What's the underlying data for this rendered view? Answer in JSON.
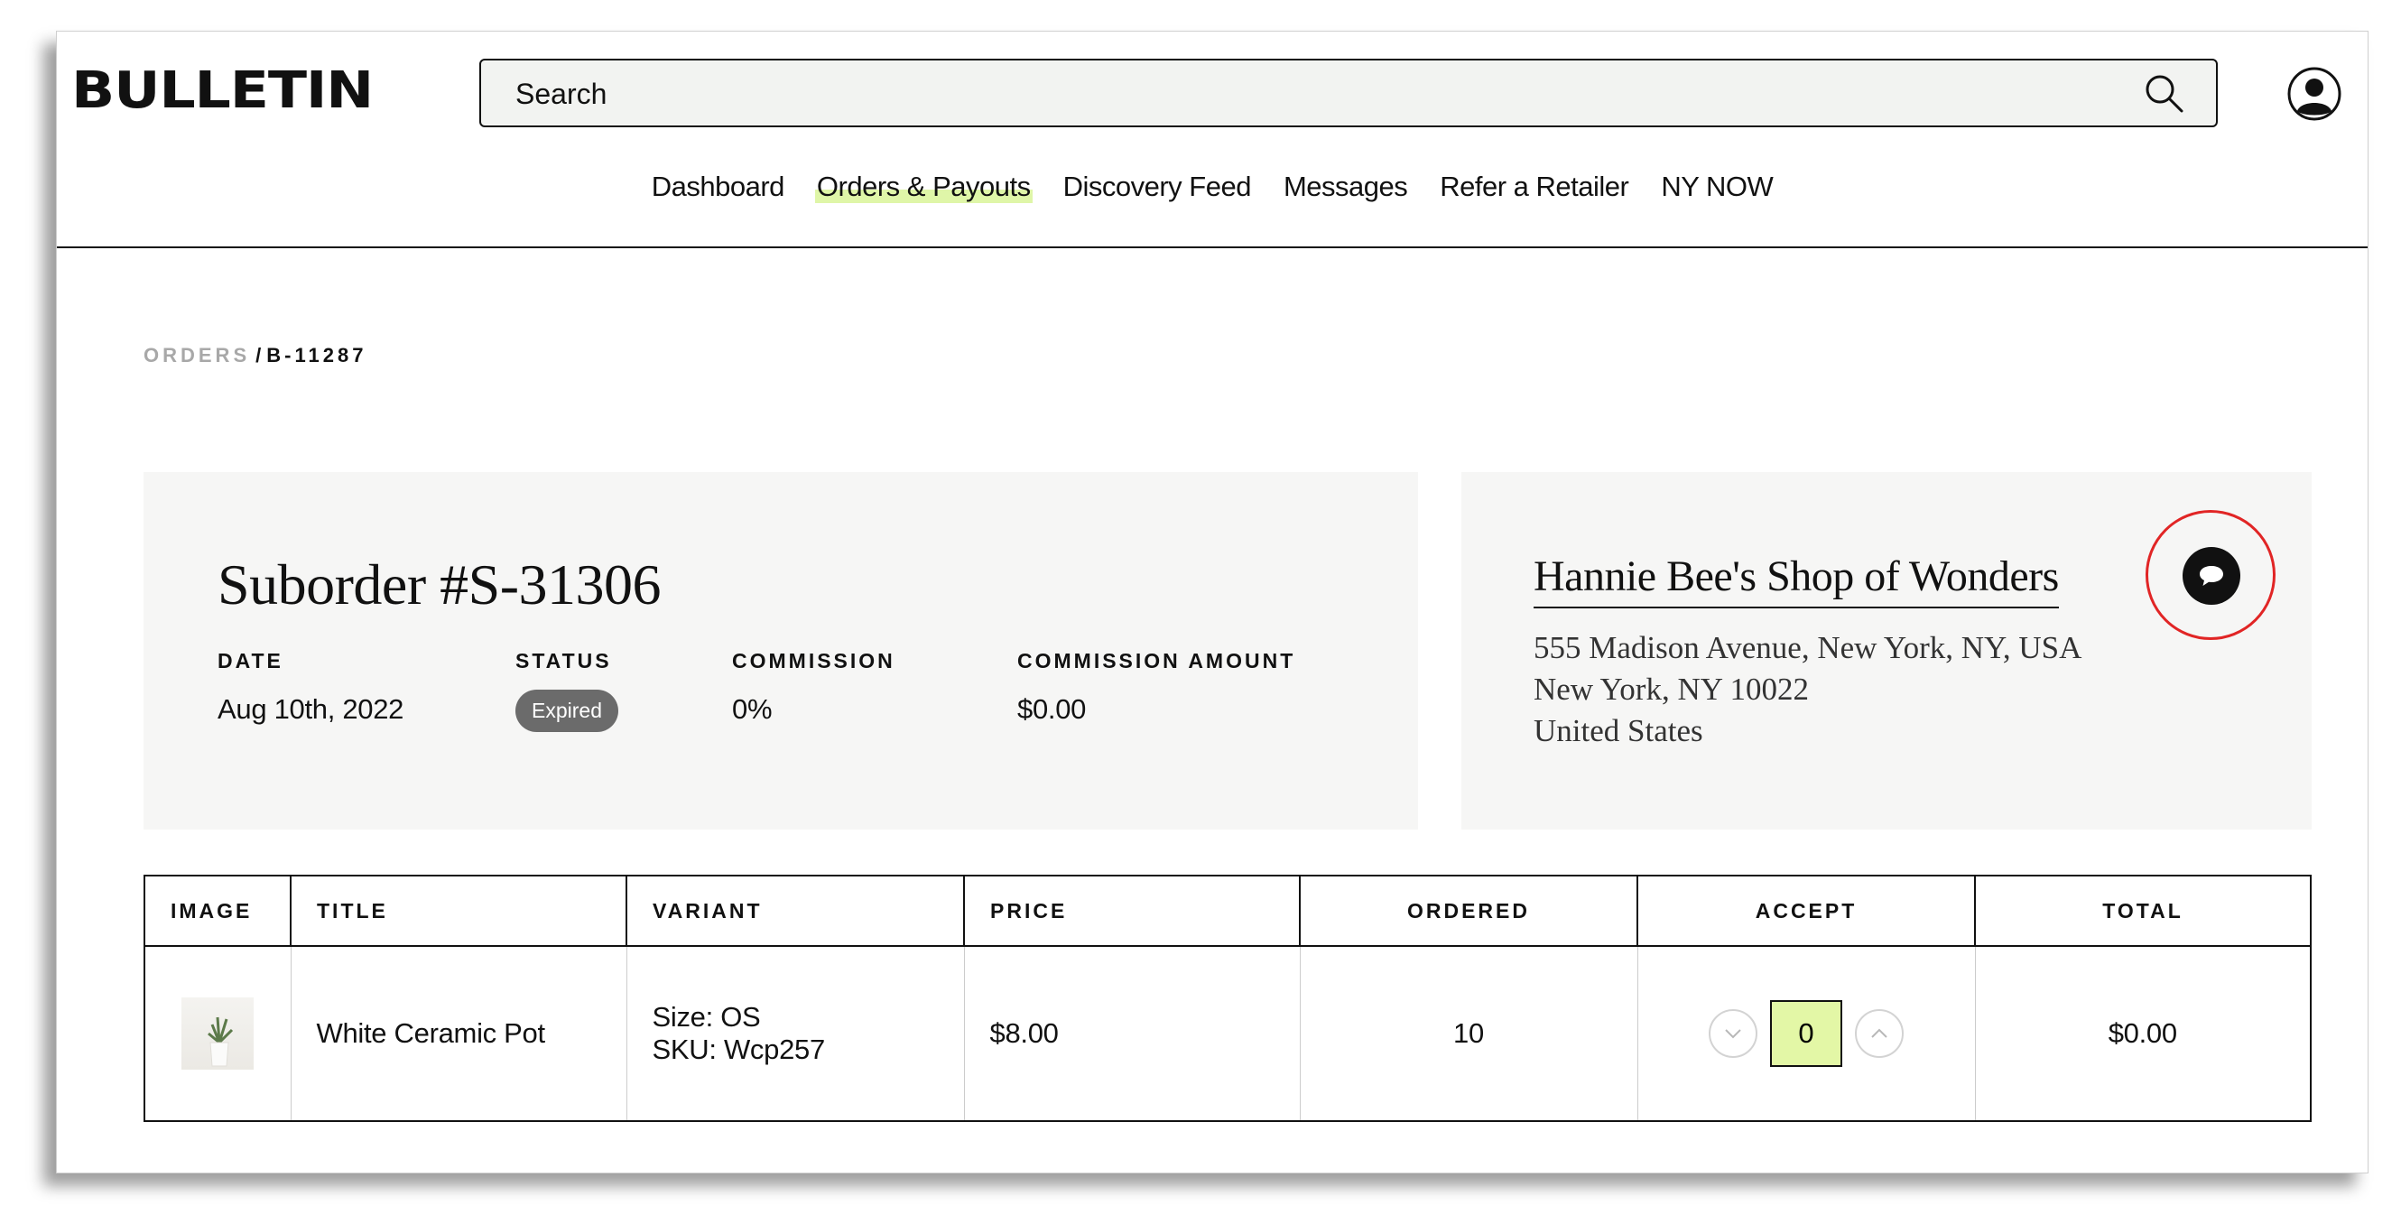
{
  "brand": {
    "logo": "BULLETIN"
  },
  "search": {
    "placeholder": "Search"
  },
  "nav": {
    "items": [
      "Dashboard",
      "Orders & Payouts",
      "Discovery Feed",
      "Messages",
      "Refer a Retailer",
      "NY NOW"
    ],
    "active": "Orders & Payouts",
    "highlight_color": "#dff6a8"
  },
  "breadcrumb": {
    "parent": "ORDERS",
    "separator": "/",
    "current": "B-11287"
  },
  "order": {
    "title": "Suborder #S-31306",
    "date_label": "DATE",
    "date": "Aug 10th, 2022",
    "status_label": "STATUS",
    "status": "Expired",
    "commission_label": "COMMISSION",
    "commission": "0%",
    "commission_amount_label": "COMMISSION AMOUNT",
    "commission_amount": "$0.00"
  },
  "shop": {
    "name": "Hannie Bee's Shop of Wonders",
    "address_line1": "555 Madison Avenue, New York, NY, USA",
    "address_line2": "New York, NY 10022",
    "address_line3": "United States"
  },
  "table": {
    "headers": [
      "IMAGE",
      "TITLE",
      "VARIANT",
      "PRICE",
      "ORDERED",
      "ACCEPT",
      "TOTAL"
    ],
    "rows": [
      {
        "title": "White Ceramic Pot",
        "variant_size": "Size: OS",
        "variant_sku": "SKU: Wcp257",
        "price": "$8.00",
        "ordered": "10",
        "accept": "0",
        "total": "$0.00"
      }
    ]
  },
  "colors": {
    "accent_green": "#e3f7a6",
    "status_badge": "#6b6b6b",
    "card_background": "#f6f6f5",
    "message_ring": "#e12525"
  },
  "icons": {
    "search": "search-icon",
    "user": "user-icon",
    "message": "chat-bubble-icon",
    "decrement": "chevron-down-icon",
    "increment": "chevron-up-icon"
  }
}
